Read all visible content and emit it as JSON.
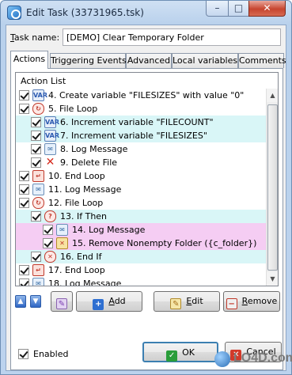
{
  "window": {
    "title": "Edit Task (33731965.tsk)",
    "min_symbol": "–",
    "max_symbol": "□",
    "close_symbol": "✕"
  },
  "task": {
    "label_accel": "T",
    "label_rest": "ask name:",
    "value": "[DEMO] Clear Temporary Folder"
  },
  "tabs": [
    {
      "label": "Actions",
      "active": true
    },
    {
      "label": "Triggering Events",
      "active": false
    },
    {
      "label": "Advanced",
      "active": false
    },
    {
      "label": "Local variables",
      "active": false
    },
    {
      "label": "Comments",
      "active": false
    }
  ],
  "action_list": {
    "header": "Action List",
    "rows": [
      {
        "text": "4. Create variable \"FILESIZES\" with value \"0\"",
        "icon": "variable-icon",
        "indent": 0,
        "highlight": "none"
      },
      {
        "text": "5. File Loop",
        "icon": "loop-icon",
        "indent": 0,
        "highlight": "none"
      },
      {
        "text": "6. Increment variable \"FILECOUNT\"",
        "icon": "variable-icon",
        "indent": 1,
        "highlight": "cyan"
      },
      {
        "text": "7. Increment variable \"FILESIZES\"",
        "icon": "variable-icon",
        "indent": 1,
        "highlight": "cyan"
      },
      {
        "text": "8. Log Message",
        "icon": "log-message-icon",
        "indent": 1,
        "highlight": "none"
      },
      {
        "text": "9. Delete File",
        "icon": "delete-icon",
        "indent": 1,
        "highlight": "none"
      },
      {
        "text": "10. End Loop",
        "icon": "end-loop-icon",
        "indent": 0,
        "highlight": "none"
      },
      {
        "text": "11. Log Message",
        "icon": "log-message-icon",
        "indent": 0,
        "highlight": "none"
      },
      {
        "text": "12. File Loop",
        "icon": "loop-icon",
        "indent": 0,
        "highlight": "none"
      },
      {
        "text": "13. If Then",
        "icon": "if-then-icon",
        "indent": 1,
        "highlight": "cyan"
      },
      {
        "text": "14. Log Message",
        "icon": "log-message-icon",
        "indent": 2,
        "highlight": "pink"
      },
      {
        "text": "15. Remove Nonempty Folder  ({c_folder})",
        "icon": "remove-folder-icon",
        "indent": 2,
        "highlight": "pink"
      },
      {
        "text": "16. End If",
        "icon": "end-if-icon",
        "indent": 1,
        "highlight": "cyan"
      },
      {
        "text": "17. End Loop",
        "icon": "end-loop-icon",
        "indent": 0,
        "highlight": "none"
      },
      {
        "text": "18. Log Message",
        "icon": "log-message-icon",
        "indent": 0,
        "highlight": "none"
      }
    ]
  },
  "buttons": {
    "up_symbol": "▲",
    "down_symbol": "▼",
    "props_symbol": "✎",
    "add_accel": "A",
    "add_rest": "dd",
    "add_symbol": "+",
    "edit_accel": "E",
    "edit_rest": "dit",
    "edit_symbol": "✎",
    "remove_accel": "R",
    "remove_rest": "emove",
    "remove_symbol": "−",
    "ok_label": "OK",
    "ok_symbol": "✓",
    "cancel_label": "Cancel",
    "cancel_symbol": "✕"
  },
  "enabled": {
    "label": "Enabled",
    "checked": true
  },
  "watermark": {
    "text": "LO4D.com"
  }
}
